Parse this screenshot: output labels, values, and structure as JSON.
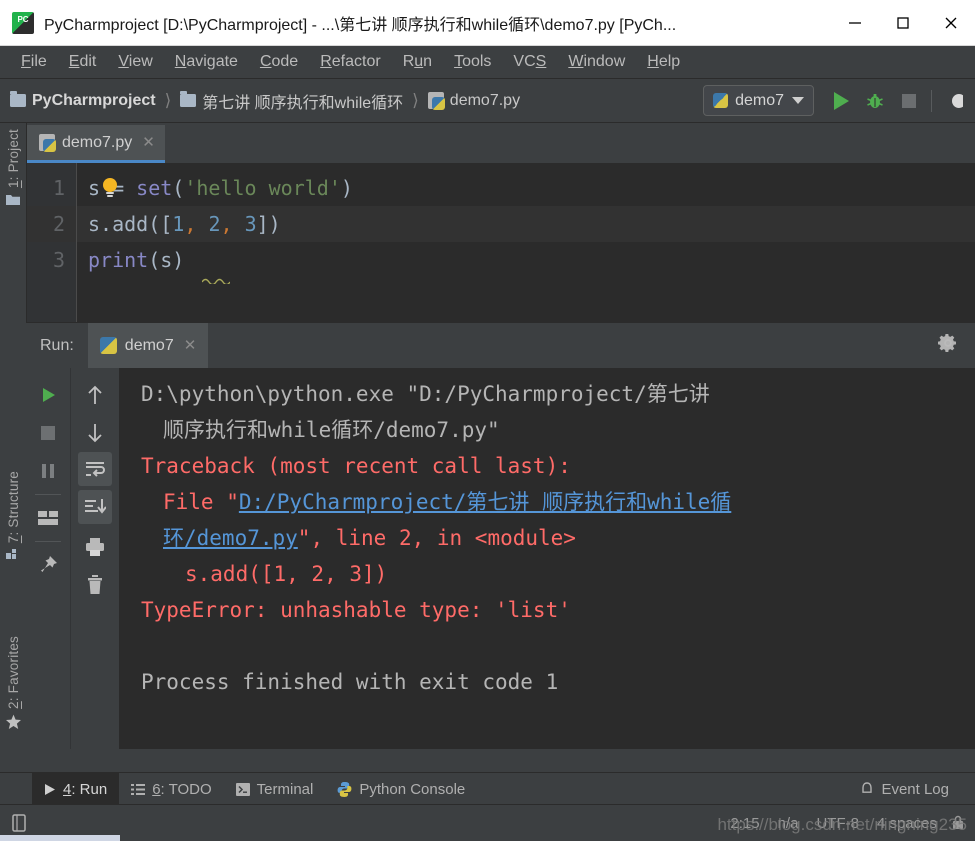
{
  "window": {
    "title": "PyCharmproject [D:\\PyCharmproject] - ...\\第七讲 顺序执行和while循环\\demo7.py [PyCh...",
    "app_icon": "pycharm-icon",
    "minimize_label": "Minimize",
    "maximize_label": "Maximize",
    "close_label": "Close"
  },
  "menu": {
    "items": [
      {
        "mnemonic": "F",
        "rest": "ile"
      },
      {
        "mnemonic": "E",
        "rest": "dit"
      },
      {
        "mnemonic": "V",
        "rest": "iew"
      },
      {
        "mnemonic": "N",
        "rest": "avigate"
      },
      {
        "mnemonic": "C",
        "rest": "ode"
      },
      {
        "mnemonic": "R",
        "rest": "efactor"
      },
      {
        "mnemonic": "Ru",
        "rest": "n",
        "pre": true
      },
      {
        "mnemonic": "T",
        "rest": "ools"
      },
      {
        "mnemonic": "VCS",
        "rest": "",
        "whole": true
      },
      {
        "mnemonic": "W",
        "rest": "indow"
      },
      {
        "mnemonic": "H",
        "rest": "elp"
      }
    ],
    "labels": [
      "File",
      "Edit",
      "View",
      "Navigate",
      "Code",
      "Refactor",
      "Run",
      "Tools",
      "VCS",
      "Window",
      "Help"
    ]
  },
  "breadcrumb": {
    "project": "PyCharmproject",
    "folder": "第七讲 顺序执行和while循环",
    "file": "demo7.py",
    "separator": "〉"
  },
  "toolbar": {
    "run_config": "demo7",
    "run_button": "run-button",
    "debug_button": "debug-button",
    "stop_button": "stop-button"
  },
  "left_rail": {
    "project_num": "1",
    "project_label": ": Project",
    "structure_num": "7",
    "structure_label": ": Structure",
    "favorites_num": "2",
    "favorites_label": ": Favorites"
  },
  "editor": {
    "tab_name": "demo7.py",
    "line_numbers": [
      "1",
      "2",
      "3"
    ],
    "current_line": 2,
    "code": [
      {
        "n": 1,
        "tokens": [
          {
            "t": "s",
            "c": "punct"
          },
          {
            "t": " = ",
            "c": "punct"
          },
          {
            "t": "set",
            "c": "fn"
          },
          {
            "t": "(",
            "c": "punct"
          },
          {
            "t": "'hello world'",
            "c": "str"
          },
          {
            "t": ")",
            "c": "punct"
          }
        ],
        "text": "s = set('hello world')"
      },
      {
        "n": 2,
        "tokens": [
          {
            "t": "s.add([",
            "c": "punct"
          },
          {
            "t": "1",
            "c": "num"
          },
          {
            "t": ", ",
            "c": "comma"
          },
          {
            "t": "2",
            "c": "num"
          },
          {
            "t": ", ",
            "c": "comma"
          },
          {
            "t": "3",
            "c": "num"
          },
          {
            "t": "])",
            "c": "punct"
          }
        ],
        "text": "s.add([1, 2, 3])"
      },
      {
        "n": 3,
        "tokens": [
          {
            "t": "print",
            "c": "fn"
          },
          {
            "t": "(s)",
            "c": "punct"
          }
        ],
        "text": "print(s)"
      }
    ]
  },
  "run_window": {
    "label": "Run:",
    "tab_name": "demo7",
    "settings_icon": "gear-icon",
    "tool_icons_left": [
      "rerun-icon",
      "stop-icon",
      "pause-icon",
      "layout-icon",
      "pin-icon"
    ],
    "tool_icons_right": [
      "up-arrow-icon",
      "down-arrow-icon",
      "soft-wrap-icon",
      "scroll-to-end-icon",
      "print-icon",
      "trash-icon"
    ],
    "output": [
      {
        "type": "plain",
        "indent": 0,
        "text": "D:\\python\\python.exe \"D:/PyCharmproject/第七讲"
      },
      {
        "type": "plain",
        "indent": 1,
        "text": "顺序执行和while循环/demo7.py\""
      },
      {
        "type": "error",
        "indent": 0,
        "text": "Traceback (most recent call last):"
      },
      {
        "type": "error-link",
        "indent": 1,
        "pre": "File \"",
        "link": "D:/PyCharmproject/第七讲 顺序执行和while循",
        "post": ""
      },
      {
        "type": "error-link2",
        "indent": 1,
        "link": "环/demo7.py",
        "post": "\", line 2, in <module>"
      },
      {
        "type": "error",
        "indent": 2,
        "text": "s.add([1, 2, 3])"
      },
      {
        "type": "error",
        "indent": 0,
        "text": "TypeError: unhashable type: 'list'"
      },
      {
        "type": "plain",
        "indent": 0,
        "text": ""
      },
      {
        "type": "plain",
        "indent": 0,
        "text": "Process finished with exit code 1"
      }
    ]
  },
  "bottom_bar": {
    "items": [
      {
        "icon": "run-triangle-icon",
        "num": "4",
        "label": ": Run",
        "active": true
      },
      {
        "icon": "todo-list-icon",
        "num": "6",
        "label": ": TODO",
        "active": false
      },
      {
        "icon": "terminal-icon",
        "num": "",
        "label": "Terminal",
        "active": false
      },
      {
        "icon": "python-console-icon",
        "num": "",
        "label": "Python Console",
        "active": false
      }
    ],
    "event_log": "Event Log",
    "event_log_icon": "bell-icon"
  },
  "status_bar": {
    "left_icon": "toggle-sidebar-icon",
    "caret_position": "2:15",
    "line_separator": "n/a",
    "encoding": "UTF-8",
    "indent": "4 spaces",
    "lock_icon": "lock-icon"
  },
  "watermark": {
    "text": "https://blog.csdn.net/ningning235"
  },
  "colors": {
    "accent_blue": "#4a88c7",
    "error_red": "#ff6b68",
    "link_blue": "#5596d8",
    "string_green": "#6a8759",
    "keyword_purple": "#8888c6",
    "number_blue": "#6897bb",
    "run_green": "#4fae4f",
    "editor_bg": "#2b2b2b",
    "chrome_bg": "#3c3f41"
  }
}
